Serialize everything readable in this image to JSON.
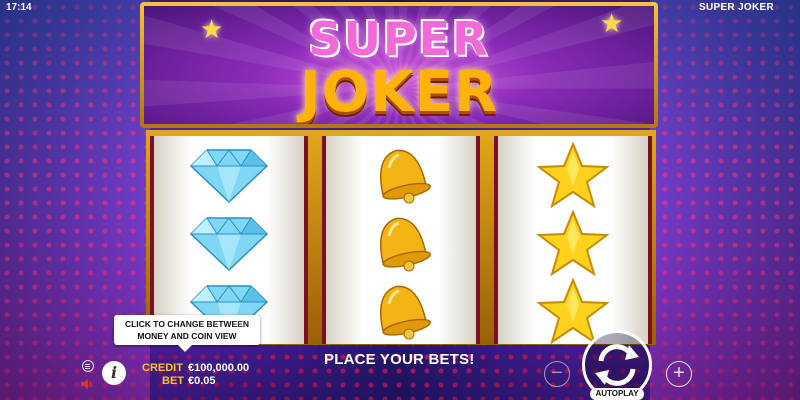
{
  "status": {
    "time": "17:14",
    "game_title": "SUPER JOKER"
  },
  "logo": {
    "line1": "SUPER",
    "line2": "JOKER"
  },
  "reels": [
    {
      "symbols": [
        "diamond",
        "diamond",
        "diamond"
      ]
    },
    {
      "symbols": [
        "bell",
        "bell",
        "bell"
      ]
    },
    {
      "symbols": [
        "star",
        "star",
        "star"
      ]
    }
  ],
  "tooltip": {
    "line1": "CLICK TO CHANGE BETWEEN",
    "line2": "MONEY AND COIN VIEW"
  },
  "bottom_bar": {
    "credit_label": "CREDIT",
    "credit_value": "€100,000.00",
    "bet_label": "BET",
    "bet_value": "€0.05",
    "message": "PLACE YOUR BETS!",
    "minus": "−",
    "plus": "+",
    "autoplay_label": "AUTOPLAY",
    "info": "i"
  },
  "icons": {
    "menu": "menu-icon",
    "sound": "speaker-icon",
    "info": "info-icon",
    "spin": "spin-arrows-icon",
    "minus": "minus-icon",
    "plus": "plus-icon"
  },
  "colors": {
    "accent_gold": "#ffc21a",
    "logo_pink": "#f26ad8",
    "logo_orange": "#ffb30a",
    "reel_border": "#7a1020"
  }
}
